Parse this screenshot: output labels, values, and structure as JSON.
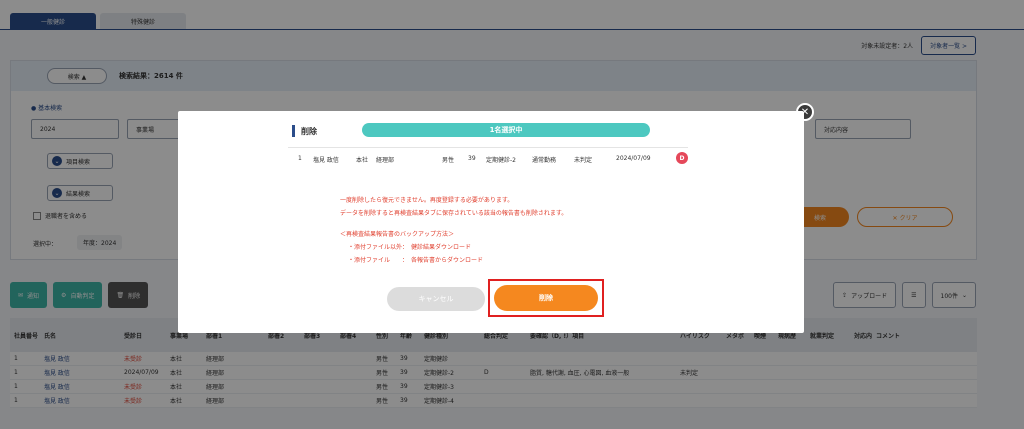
{
  "tabs": [
    "一般健診",
    "特殊健診"
  ],
  "meta": {
    "unset_label": "対象未設定者：2人",
    "list_button": "対象者一覧 >"
  },
  "search": {
    "toggle_label": "検索 ▲",
    "result": "検索結果：2614 件",
    "basic_label": "● 基本検索",
    "year": "2024",
    "office": "事業場",
    "response": "対応内容",
    "item_search": "項目検索",
    "result_search": "結果検索",
    "include_retired": "退職者を含める",
    "selected_label": "選択中：",
    "selected_chip": "年度：2024",
    "search_btn": "検索",
    "clear_btn": "✕ クリア"
  },
  "actions": {
    "notify": "通知",
    "auto_judge": "自動判定",
    "delete": "削除",
    "upload": "アップロード",
    "per_page": "100件"
  },
  "table": {
    "headers": [
      "社員番号",
      "氏名",
      "受診日",
      "事業場",
      "部署1",
      "部署2",
      "部署3",
      "部署4",
      "性別",
      "年齢",
      "健診種別",
      "総合判定",
      "要確認（D, !）項目",
      "ハイリスク",
      "メタボ",
      "喫煙",
      "現病歴",
      "就業判定",
      "対応内容",
      "コメント"
    ],
    "rows": [
      [
        "1",
        "塩見 政信",
        "未受診",
        "本社",
        "経理部",
        "男性",
        "39",
        "定期健診",
        "",
        "",
        ""
      ],
      [
        "1",
        "塩見 政信",
        "2024/07/09",
        "本社",
        "経理部",
        "男性",
        "39",
        "定期健診-2",
        "D",
        "脂質, 糖代謝, 血圧, 心電図, 血液一般",
        "未判定"
      ],
      [
        "1",
        "塩見 政信",
        "未受診",
        "本社",
        "経理部",
        "男性",
        "39",
        "定期健診-3",
        "",
        "",
        ""
      ],
      [
        "1",
        "塩見 政信",
        "未受診",
        "本社",
        "経理部",
        "男性",
        "39",
        "定期健診-4",
        "",
        "",
        ""
      ]
    ]
  },
  "modal": {
    "title": "削除",
    "badge": "1名選択中",
    "row": [
      "1",
      "塩見 政信",
      "本社",
      "経理部",
      "男性",
      "39",
      "定期健診-2",
      "通常勤務",
      "未判定",
      "2024/07/09"
    ],
    "judge_badge": "D",
    "warnings": [
      "一度削除したら復元できません。再度登録する必要があります。",
      "データを削除すると再検査結果タブに保存されている該当の報告書も削除されます。"
    ],
    "backup_title": "＜再検査結果報告書のバックアップ方法＞",
    "backup_lines": [
      "・添付ファイル以外：　健診結果ダウンロード",
      "・添付ファイル　　：　各報告書からダウンロード"
    ],
    "cancel": "キャンセル",
    "confirm": "削除"
  }
}
